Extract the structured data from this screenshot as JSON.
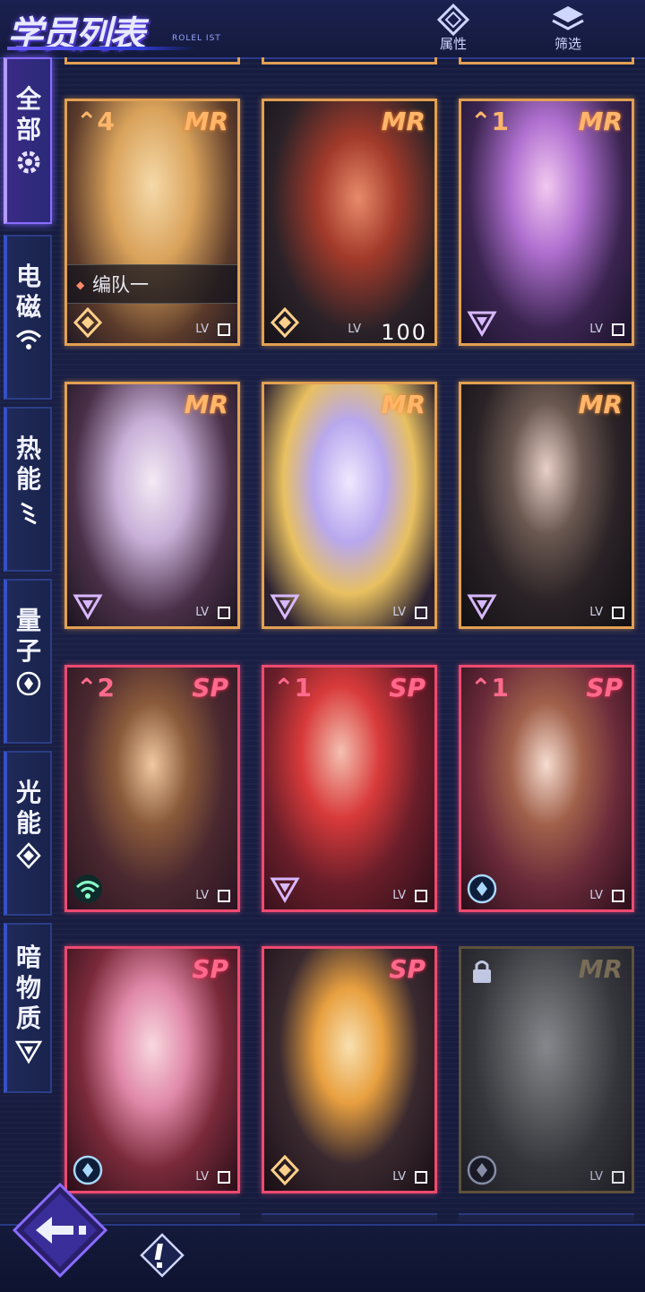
{
  "header": {
    "title": "学员列表",
    "title_sub": "ROLEL IST",
    "attributes_label": "属性",
    "filter_label": "筛选"
  },
  "sidebar": {
    "tabs": [
      {
        "label": "全部",
        "icon": "all-gear-icon",
        "active": true
      },
      {
        "label": "电磁",
        "icon": "wifi-icon",
        "active": false
      },
      {
        "label": "热能",
        "icon": "heat-icon",
        "active": false
      },
      {
        "label": "量子",
        "icon": "quantum-icon",
        "active": false
      },
      {
        "label": "光能",
        "icon": "light-diamond-icon",
        "active": false
      },
      {
        "label": "暗物质",
        "icon": "dark-triangle-icon",
        "active": false
      }
    ]
  },
  "cards": [
    {
      "rarity": "MR",
      "star": "^4",
      "team": "编队一",
      "attr": "light-diamond-icon",
      "lv_label": "LV",
      "lv_value": ""
    },
    {
      "rarity": "MR",
      "star": "",
      "team": "",
      "attr": "light-diamond-icon",
      "lv_label": "LV",
      "lv_value": "100"
    },
    {
      "rarity": "MR",
      "star": "^1",
      "team": "",
      "attr": "dark-triangle-icon",
      "lv_label": "LV",
      "lv_value": ""
    },
    {
      "rarity": "MR",
      "star": "",
      "team": "",
      "attr": "dark-triangle-icon",
      "lv_label": "LV",
      "lv_value": ""
    },
    {
      "rarity": "MR",
      "star": "",
      "team": "",
      "attr": "dark-triangle-icon",
      "lv_label": "LV",
      "lv_value": ""
    },
    {
      "rarity": "MR",
      "star": "",
      "team": "",
      "attr": "dark-triangle-icon",
      "lv_label": "LV",
      "lv_value": ""
    },
    {
      "rarity": "SP",
      "star": "^2",
      "team": "",
      "attr": "wifi-icon",
      "lv_label": "LV",
      "lv_value": ""
    },
    {
      "rarity": "SP",
      "star": "^1",
      "team": "",
      "attr": "dark-triangle-icon",
      "lv_label": "LV",
      "lv_value": ""
    },
    {
      "rarity": "SP",
      "star": "^1",
      "team": "",
      "attr": "quantum-icon",
      "lv_label": "LV",
      "lv_value": ""
    },
    {
      "rarity": "SP",
      "star": "",
      "team": "",
      "attr": "quantum-icon",
      "lv_label": "LV",
      "lv_value": ""
    },
    {
      "rarity": "SP",
      "star": "",
      "team": "",
      "attr": "light-diamond-icon",
      "lv_label": "LV",
      "lv_value": ""
    },
    {
      "rarity": "MR",
      "star": "",
      "team": "",
      "attr": "quantum-icon",
      "lv_label": "LV",
      "lv_value": "",
      "locked": true
    }
  ],
  "colors": {
    "mr_border": "#e2a052",
    "sp_border": "#ee4a70",
    "accent": "#7a5cff",
    "background": "#161c3e"
  }
}
